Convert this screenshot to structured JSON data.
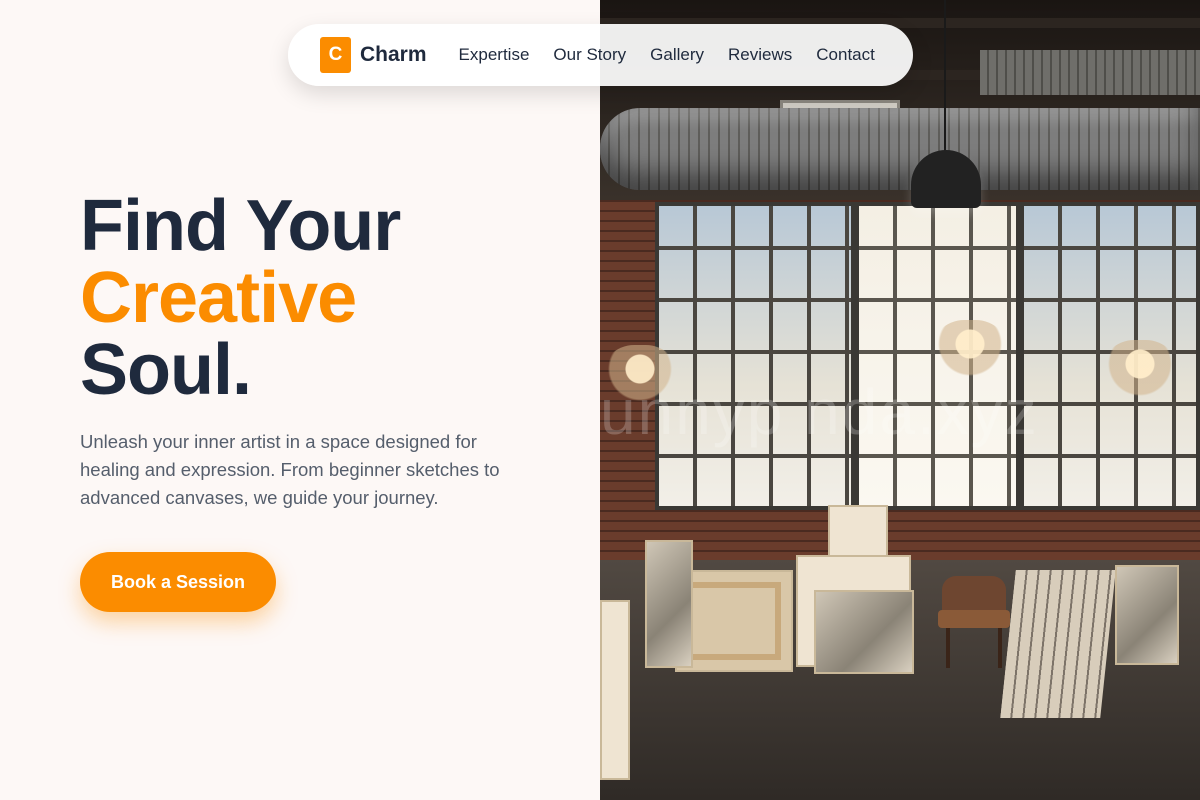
{
  "brand": {
    "initial": "C",
    "name": "Charm"
  },
  "nav": {
    "items": [
      "Expertise",
      "Our Story",
      "Gallery",
      "Reviews",
      "Contact"
    ]
  },
  "hero": {
    "line1": "Find Your",
    "line2": "Creative",
    "line3": "Soul.",
    "description": "Unleash your inner artist in a space designed for healing and expression. From beginner sketches to advanced canvases, we guide your journey.",
    "cta_label": "Book a Session"
  },
  "image": {
    "watermark": "unnyp     nda.xyz"
  },
  "colors": {
    "accent": "#fb8c00",
    "title_dark": "#1f2a3d",
    "body_text": "#555e6c",
    "background": "#fdf8f6"
  }
}
